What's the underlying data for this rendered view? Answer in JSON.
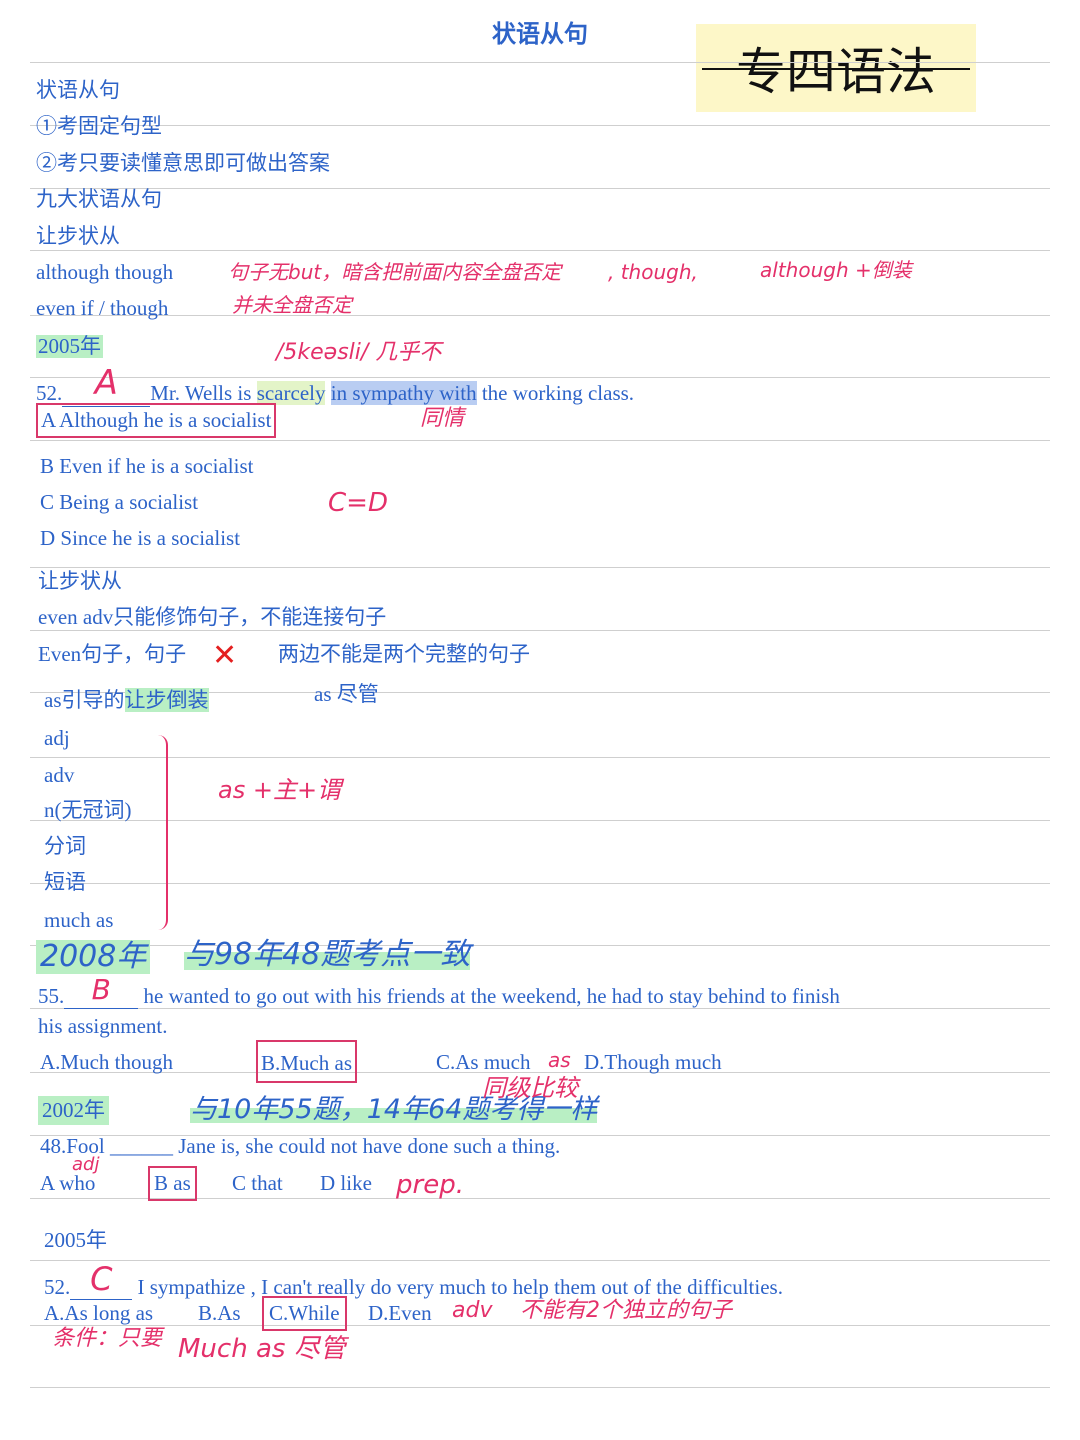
{
  "title": "状语从句",
  "stamp": "专四语法",
  "lines": {
    "l1": "状语从句",
    "l2": "①考固定句型",
    "l3": "②考只要读懂意思即可做出答案",
    "l4": "九大状语从句",
    "l5": "让步状从",
    "l6": "although though",
    "l7": "even if / though",
    "y1": "2005年",
    "q52a_num": "52.",
    "q52a_ans": "A",
    "q52a_pre": "Mr. Wells is ",
    "q52a_hl1": "scarcely",
    "q52a_hl2": "in sympathy with",
    "q52a_post": " the working class.",
    "q52a_A": "A Although he is a socialist",
    "q52a_B": "B Even if he is a socialist",
    "q52a_C": "C Being  a  socialist",
    "q52a_D": "D Since he is a socialist",
    "l8": "让步状从",
    "l9": "even   adv只能修饰句子，不能连接句子",
    "l10": "Even句子，句子",
    "l10b": "两边不能是两个完整的句子",
    "l11": "as引导的",
    "l11hl": "让步倒装",
    "l11b": "as 尽管",
    "list": [
      "adj",
      "adv",
      "n(无冠词)",
      "分词",
      "短语",
      "much as"
    ],
    "y2": "2008年",
    "q55_num": "55.",
    "q55_ans": "B",
    "q55_text": "he wanted to go out with his friends at the weekend,  he had to stay behind to finish",
    "q55_text2": "his assignment.",
    "q55_A": "A.Much though",
    "q55_B": "B.Much  as",
    "q55_C": "C.As much",
    "q55_D": "D.Though  much",
    "y3": "2002年",
    "q48_text": "48.Fool ______ Jane  is,  she  could  not  have  done  such  a  thing.",
    "q48_A": "A who",
    "q48_B": "B  as",
    "q48_C": "C that",
    "q48_D": "D like",
    "y4": "2005年",
    "q52b_num": "52.",
    "q52b_ans": "C",
    "q52b_text": "I  sympathize ,  I can't really do very much to help them out of the difficulties.",
    "q52b_A": "A.As long as",
    "q52b_B": "B.As",
    "q52b_C": "C.While",
    "q52b_D": "D.Even"
  },
  "notes": {
    "n1": "句子无but，暗含把前面内容全盘否定",
    "n2": ", though,",
    "n3": "although +倒装",
    "n4": "并未全盘否定",
    "n5": "/5keəsli/ 几乎不",
    "n6": "同情",
    "n7": "C=D",
    "n8": "as +主+谓",
    "n9": "与98年48题考点一致",
    "n10": "as",
    "n11": "同级比较",
    "n12": "与10年55题，14年64题考得一样",
    "n13": "adj",
    "n14": "prep.",
    "n15": "adv",
    "n16": "不能有2个独立的句子",
    "n17": "条件：只要",
    "n18": "Much as  尽管"
  }
}
